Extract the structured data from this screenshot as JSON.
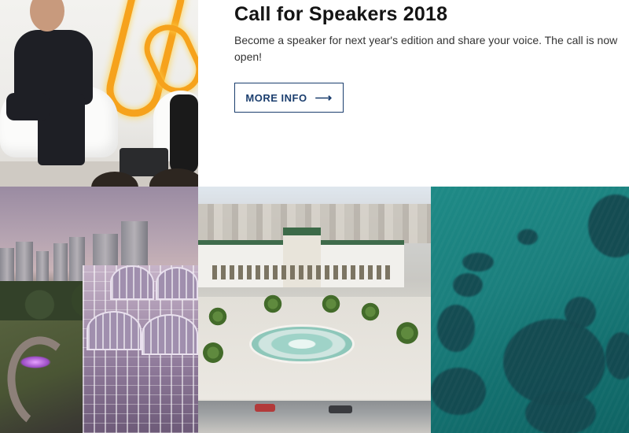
{
  "call_for_speakers": {
    "title": "Call for Speakers 2018",
    "description": "Become a speaker for next year's edition and share your voice. The call is now open!",
    "button_label": "MORE INFO",
    "button_icon": "arrow-right-icon"
  },
  "colors": {
    "accent": "#1b3e6e",
    "title_text": "#141414",
    "body_text": "#333333",
    "background": "#ffffff",
    "neon": "#f6a21c",
    "ocean": "#1b7f7d"
  },
  "photos": [
    "speaker-on-stage",
    "city-greenhouse-at-dusk",
    "plaza-with-fountain",
    "aerial-ocean-reef"
  ]
}
